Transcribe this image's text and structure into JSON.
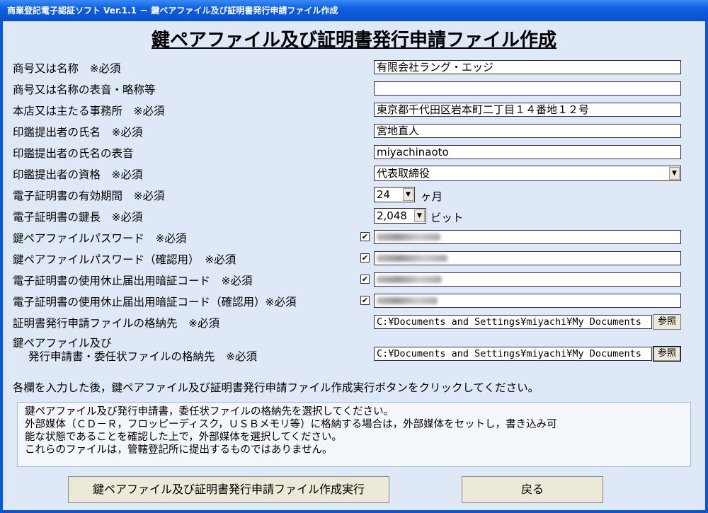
{
  "window": {
    "title": "商業登記電子認証ソフト Ver.1.1 － 鍵ペアファイル及び証明書発行申請ファイル作成"
  },
  "heading": "鍵ペアファイル及び証明書発行申請ファイル作成",
  "fields": {
    "trade_name_label": "商号又は名称　※必須",
    "trade_name_value": "有限会社ラング・エッジ",
    "trade_name_reading_label": "商号又は名称の表音・略称等",
    "trade_name_reading_value": "",
    "head_office_label": "本店又は主たる事務所　※必須",
    "head_office_value": "東京都千代田区岩本町二丁目１４番地１２号",
    "seal_name_label": "印鑑提出者の氏名　※必須",
    "seal_name_value": "宮地直人",
    "seal_name_reading_label": "印鑑提出者の氏名の表音",
    "seal_name_reading_value": "miyachinaoto",
    "qualification_label": "印鑑提出者の資格　※必須",
    "qualification_value": "代表取締役",
    "validity_label": "電子証明書の有効期間　※必須",
    "validity_value": "24",
    "validity_unit": "ヶ月",
    "key_length_label": "電子証明書の鍵長　※必須",
    "key_length_value": "2,048",
    "key_length_unit": "ビット",
    "keypair_pw_label": "鍵ペアファイルパスワード　※必須",
    "keypair_pw_confirm_label": "鍵ペアファイルパスワード（確認用）　※必須",
    "suspend_code_label": "電子証明書の使用休止届出用暗証コード　※必須",
    "suspend_code_confirm_label": "電子証明書の使用休止届出用暗証コード（確認用）※必須",
    "check_mark": "✔",
    "cert_path_label": "証明書発行申請ファイルの格納先　※必須",
    "cert_path_value": "C:¥Documents and Settings¥miyachi¥My Documents",
    "keypair_path_label_1": "鍵ペアファイル及び",
    "keypair_path_label_2": "発行申請書・委任状ファイルの格納先　※必須",
    "keypair_path_value": "C:¥Documents and Settings¥miyachi¥My Documents",
    "browse_label": "参照",
    "dropdown_arrow": "▼"
  },
  "instruction": "各欄を入力した後，鍵ペアファイル及び証明書発行申請ファイル作成実行ボタンをクリックしてください。",
  "info_lines": [
    "鍵ペアファイル及び発行申請書，委任状ファイルの格納先を選択してください。",
    "外部媒体（ＣＤ－Ｒ，フロッピーディスク，ＵＳＢメモリ等）に格納する場合は，外部媒体をセットし，書き込み可",
    "能な状態であることを確認した上で，外部媒体を選択してください。",
    "これらのファイルは，管轄登記所に提出するものではありません。"
  ],
  "buttons": {
    "execute_label": "鍵ペアファイル及び証明書発行申請ファイル作成実行",
    "back_label": "戻る"
  }
}
